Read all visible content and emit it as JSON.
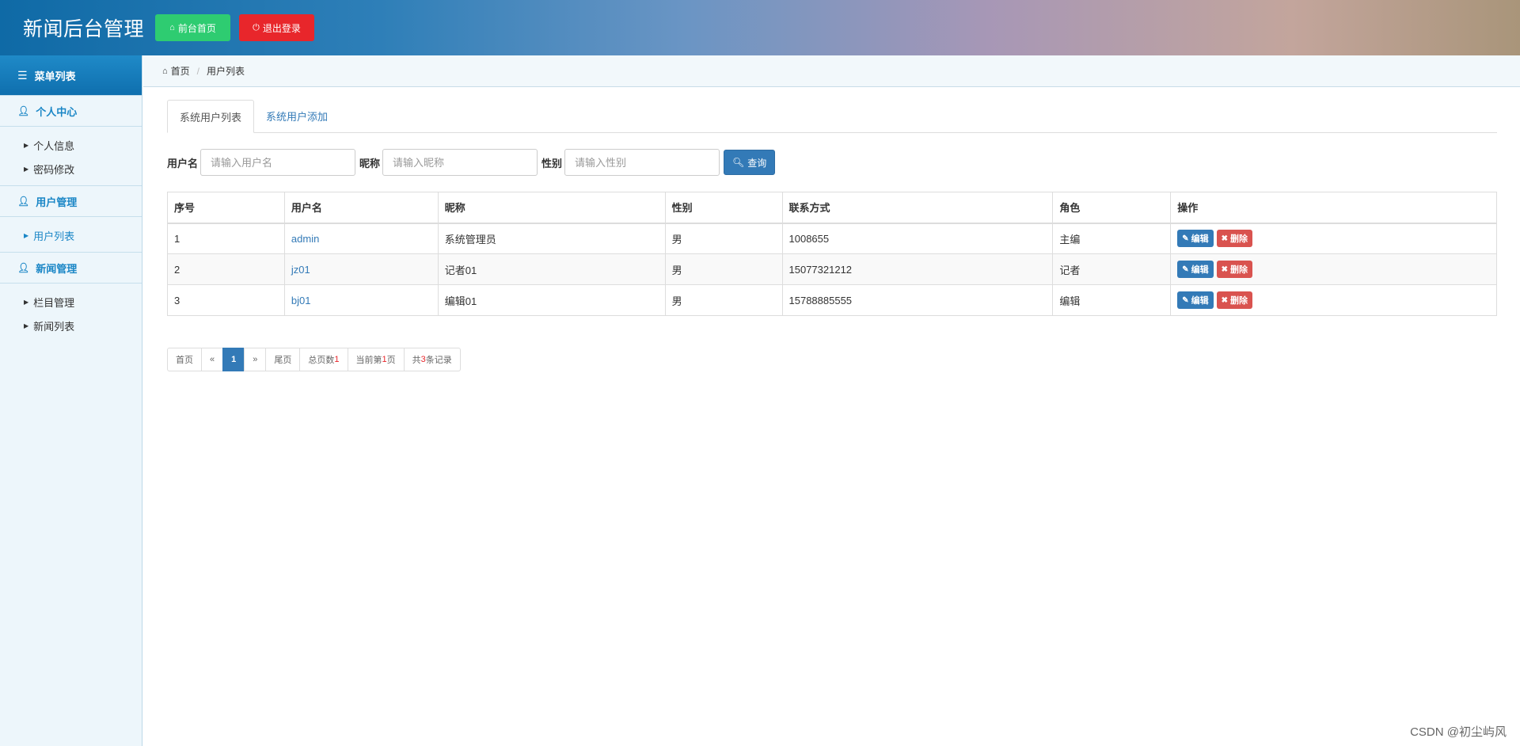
{
  "header": {
    "title": "新闻后台管理",
    "home_button": "前台首页",
    "logout_button": "退出登录",
    "colors": {
      "home": "#2ecc71",
      "logout": "#e8262b"
    }
  },
  "sidebar": {
    "title": "菜单列表",
    "sections": [
      {
        "label": "个人中心",
        "items": [
          {
            "label": "个人信息"
          },
          {
            "label": "密码修改"
          }
        ]
      },
      {
        "label": "用户管理",
        "items": [
          {
            "label": "用户列表"
          }
        ]
      },
      {
        "label": "新闻管理",
        "items": [
          {
            "label": "栏目管理"
          },
          {
            "label": "新闻列表"
          }
        ]
      }
    ]
  },
  "breadcrumb": {
    "home": "首页",
    "current": "用户列表"
  },
  "tabs": [
    {
      "label": "系统用户列表"
    },
    {
      "label": "系统用户添加"
    }
  ],
  "search": {
    "username_label": "用户名",
    "username_placeholder": "请输入用户名",
    "nickname_label": "昵称",
    "nickname_placeholder": "请输入昵称",
    "gender_label": "性别",
    "gender_placeholder": "请输入性别",
    "query_button": "查询"
  },
  "table": {
    "headers": [
      "序号",
      "用户名",
      "昵称",
      "性别",
      "联系方式",
      "角色",
      "操作"
    ],
    "rows": [
      {
        "no": "1",
        "username": "admin",
        "nickname": "系统管理员",
        "gender": "男",
        "contact": "1008655",
        "role": "主编"
      },
      {
        "no": "2",
        "username": "jz01",
        "nickname": "记者01",
        "gender": "男",
        "contact": "15077321212",
        "role": "记者"
      },
      {
        "no": "3",
        "username": "bj01",
        "nickname": "编辑01",
        "gender": "男",
        "contact": "15788885555",
        "role": "编辑"
      }
    ],
    "edit_label": "编辑",
    "delete_label": "删除"
  },
  "pager": {
    "first": "首页",
    "prev": "«",
    "current_page": "1",
    "next": "»",
    "last": "尾页",
    "total_pages_label": "总页数",
    "total_pages": "1",
    "current_label_pre": "当前第",
    "current_value": "1",
    "current_label_post": "页",
    "records_pre": "共",
    "records_value": "3",
    "records_post": "条记录"
  },
  "watermark": "CSDN @初尘屿风"
}
